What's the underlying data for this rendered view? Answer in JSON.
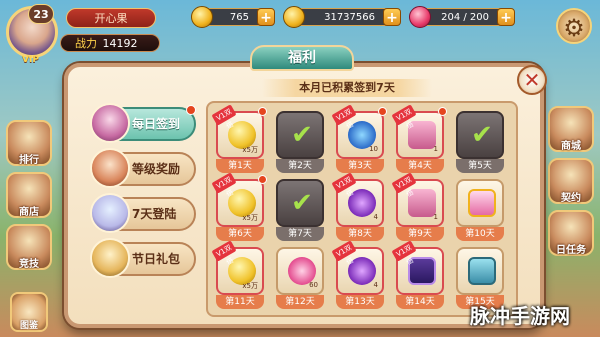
{
  "hud": {
    "level": "23",
    "vip": "VIP",
    "player_name": "开心果",
    "power_label": "战力",
    "power_value": "14192",
    "coins": "765",
    "gold": "31737566",
    "stamina": "204 / 200",
    "plus": "+",
    "settings_icon": "gear-icon"
  },
  "side_left": [
    "排行",
    "商店",
    "竞技"
  ],
  "side_right": [
    "商城",
    "契约",
    "日任务"
  ],
  "bottom_left": "图鉴",
  "dialog": {
    "title": "福利",
    "close": "✕",
    "header": "本月已积累签到7天",
    "tabs": [
      {
        "label": "每日签到",
        "active": true
      },
      {
        "label": "等级奖励",
        "active": false
      },
      {
        "label": "7天登陆",
        "active": false
      },
      {
        "label": "节日礼包",
        "active": false
      }
    ],
    "ribbon": "V1双倍",
    "cells": [
      {
        "day": "第1天",
        "item": "coin",
        "qty": "x5万",
        "state": "open",
        "double": true
      },
      {
        "day": "第2天",
        "item": "check",
        "qty": "",
        "state": "collected",
        "double": false
      },
      {
        "day": "第3天",
        "item": "candy",
        "qty": "10",
        "state": "open",
        "double": true
      },
      {
        "day": "第4天",
        "item": "chest",
        "qty": "1",
        "state": "open",
        "double": true
      },
      {
        "day": "第5天",
        "item": "check",
        "qty": "",
        "state": "collected",
        "double": false
      },
      {
        "day": "第6天",
        "item": "coin",
        "qty": "x5万",
        "state": "open",
        "double": true
      },
      {
        "day": "第7天",
        "item": "check",
        "qty": "",
        "state": "collected",
        "double": false
      },
      {
        "day": "第8天",
        "item": "purple",
        "qty": "4",
        "state": "open",
        "double": true
      },
      {
        "day": "第9天",
        "item": "chest",
        "qty": "1",
        "state": "open",
        "double": true
      },
      {
        "day": "第10天",
        "item": "gold-pink",
        "qty": "",
        "state": "open",
        "double": false
      },
      {
        "day": "第11天",
        "item": "coin",
        "qty": "x5万",
        "state": "open",
        "double": true
      },
      {
        "day": "第12天",
        "item": "heart",
        "qty": "60",
        "state": "open",
        "double": false
      },
      {
        "day": "第13天",
        "item": "purple",
        "qty": "4",
        "state": "open",
        "double": true
      },
      {
        "day": "第14天",
        "item": "frame",
        "qty": "",
        "state": "open",
        "double": true
      },
      {
        "day": "第15天",
        "item": "card",
        "qty": "",
        "state": "open",
        "double": false
      }
    ]
  },
  "watermark": "脉冲手游网"
}
